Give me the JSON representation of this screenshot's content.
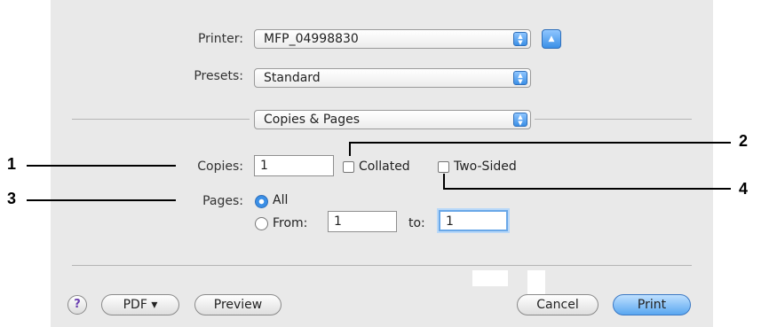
{
  "printer": {
    "label": "Printer:",
    "value": "MFP_04998830"
  },
  "presets": {
    "label": "Presets:",
    "value": "Standard"
  },
  "section": {
    "value": "Copies & Pages"
  },
  "copies": {
    "label": "Copies:",
    "value": "1",
    "collated_label": "Collated",
    "collated_checked": false,
    "two_sided_label": "Two-Sided",
    "two_sided_checked": false
  },
  "pages": {
    "label": "Pages:",
    "all_label": "All",
    "from_label": "From:",
    "from_value": "1",
    "to_label": "to:",
    "to_value": "1",
    "selected": "All"
  },
  "buttons": {
    "help": "?",
    "pdf": "PDF ▾",
    "preview": "Preview",
    "cancel": "Cancel",
    "print": "Print"
  },
  "callouts": [
    "1",
    "2",
    "3",
    "4"
  ],
  "colors": {
    "panel": "#e9e9e9",
    "accent": "#3b8fe6"
  }
}
